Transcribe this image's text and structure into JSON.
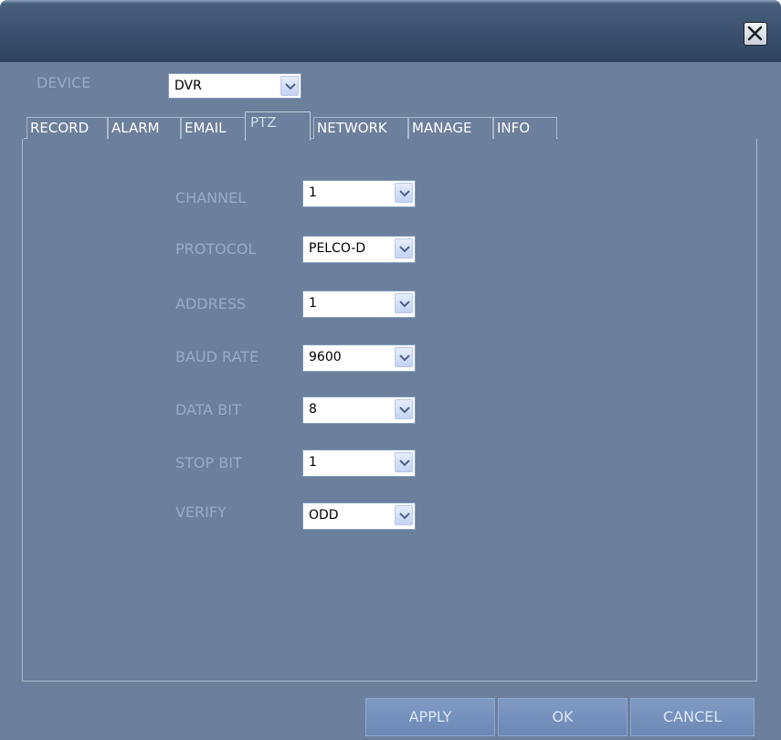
{
  "window": {
    "close_icon": "close-icon"
  },
  "device": {
    "label": "DEVICE",
    "value": "DVR"
  },
  "tabs": [
    {
      "label": "RECORD"
    },
    {
      "label": "ALARM"
    },
    {
      "label": "EMAIL"
    },
    {
      "label": "PTZ",
      "active": true
    },
    {
      "label": "NETWORK"
    },
    {
      "label": "MANAGE"
    },
    {
      "label": "INFO"
    }
  ],
  "ptz": {
    "channel": {
      "label": "CHANNEL",
      "value": "1"
    },
    "protocol": {
      "label": "PROTOCOL",
      "value": "PELCO-D"
    },
    "address": {
      "label": "ADDRESS",
      "value": "1"
    },
    "baud_rate": {
      "label": "BAUD RATE",
      "value": "9600"
    },
    "data_bit": {
      "label": "DATA BIT",
      "value": "8"
    },
    "stop_bit": {
      "label": "STOP BIT",
      "value": "1"
    },
    "verify": {
      "label": "VERIFY",
      "value": "ODD"
    }
  },
  "buttons": {
    "apply": "APPLY",
    "ok": "OK",
    "cancel": "CANCEL"
  },
  "colors": {
    "window_bg": "#6c7f9c",
    "titlebar": "#3a506e",
    "label_text": "#9aabc4",
    "button": "#7590bc"
  }
}
